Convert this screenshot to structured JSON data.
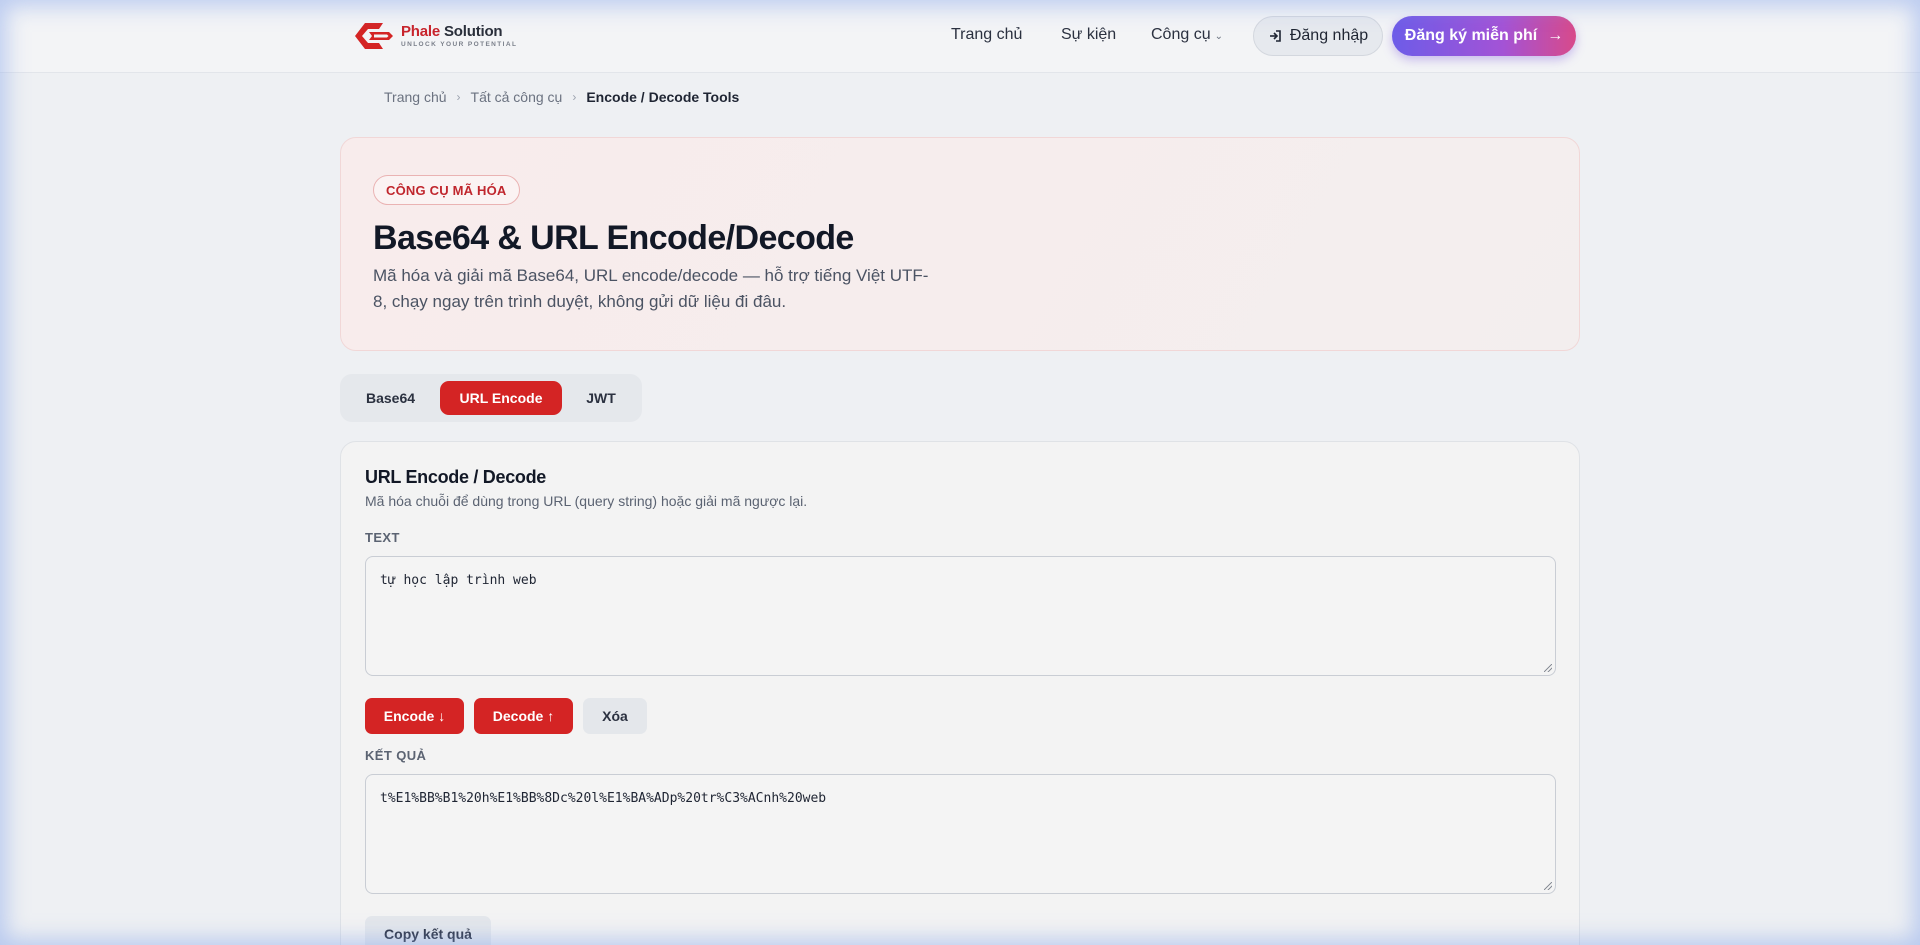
{
  "brand": {
    "name": "Phale",
    "name_suffix": " Solution",
    "tagline": "UNLOCK YOUR POTENTIAL",
    "accent": "#d42424"
  },
  "nav": {
    "home": "Trang chủ",
    "events": "Sự kiện",
    "tools": "Công cụ",
    "tools_icon": "chevron-down-icon",
    "login": "Đăng nhập",
    "signup": "Đăng ký miễn phí"
  },
  "breadcrumb": {
    "items": [
      "Trang chủ",
      "Tất cả công cụ"
    ],
    "current": "Encode / Decode Tools"
  },
  "hero": {
    "badge": "CÔNG CỤ MÃ HÓA",
    "title": "Base64 & URL Encode/Decode",
    "description": "Mã hóa và giải mã Base64, URL encode/decode — hỗ trợ tiếng Việt UTF-8, chạy ngay trên trình duyệt, không gửi dữ liệu đi đâu."
  },
  "tabs": [
    {
      "label": "Base64",
      "active": false
    },
    {
      "label": "URL Encode",
      "active": true
    },
    {
      "label": "JWT",
      "active": false
    }
  ],
  "tool": {
    "title": "URL Encode / Decode",
    "subtitle": "Mã hóa chuỗi để dùng trong URL (query string) hoặc giải mã ngược lại.",
    "input_label": "TEXT",
    "input_value": "tự học lập trình web",
    "encode_label": "Encode ↓",
    "decode_label": "Decode ↑",
    "clear_label": "Xóa",
    "output_label": "KẾT QUẢ",
    "output_value": "t%E1%BB%B1%20h%E1%BB%8Dc%20l%E1%BA%ADp%20tr%C3%ACnh%20web",
    "copy_label": "Copy kết quả"
  }
}
